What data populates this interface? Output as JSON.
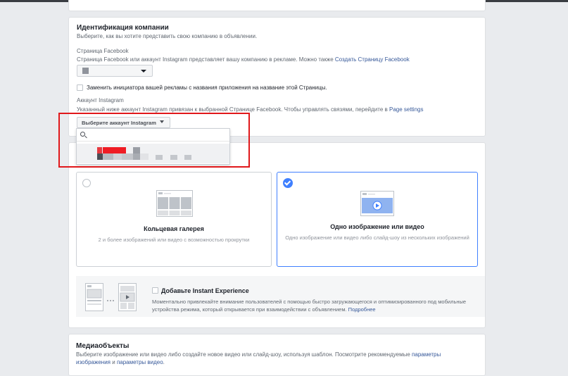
{
  "identification": {
    "title": "Идентификация компании",
    "subtitle": "Выберите, как вы хотите представить свою компанию в объявлении.",
    "facebook_page_label": "Страница Facebook",
    "facebook_page_desc": "Страница Facebook или аккаунт Instagram представляет вашу компанию в рекламе. Можно также",
    "create_page_link": "Создать Страницу Facebook",
    "replace_initiator_label": "Заменить инициатора вашей рекламы с названия приложения на название этой Страницы.",
    "instagram_label": "Аккаунт Instagram",
    "instagram_desc": "Указанный ниже аккаунт Instagram привязан к выбранной Странице Facebook. Чтобы управлять связями, перейдите в",
    "page_settings_link": "Page settings",
    "instagram_select_label": "Выберите аккаунт Instagram",
    "instagram_search_placeholder": ""
  },
  "format": {
    "carousel": {
      "title": "Кольцевая галерея",
      "desc": "2 и более изображений или видео с возможностью прокрутки"
    },
    "single": {
      "title": "Одно изображение или видео",
      "desc": "Одно изображение или видео либо слайд-шоу из нескольких изображений"
    },
    "instant_experience": {
      "title": "Добавьте Instant Experience",
      "desc": "Моментально привлекайте внимание пользователей с помощью быстро загружающегося и оптимизированного под мобильные устройства режима, который открывается при взаимодействии с объявлением.",
      "link": "Подробнее"
    }
  },
  "media": {
    "title": "Медиаобъекты",
    "desc": "Выберите изображение или видео либо создайте новое видео или слайд-шоу, используя шаблон. Посмотрите рекомендуемые",
    "link1": "параметры изображения",
    "and": "и",
    "link2": "параметры видео",
    "period": "."
  },
  "colors": {
    "accent": "#4080ff",
    "link": "#365899",
    "highlight": "#e0181b",
    "background": "#e9ebee"
  }
}
